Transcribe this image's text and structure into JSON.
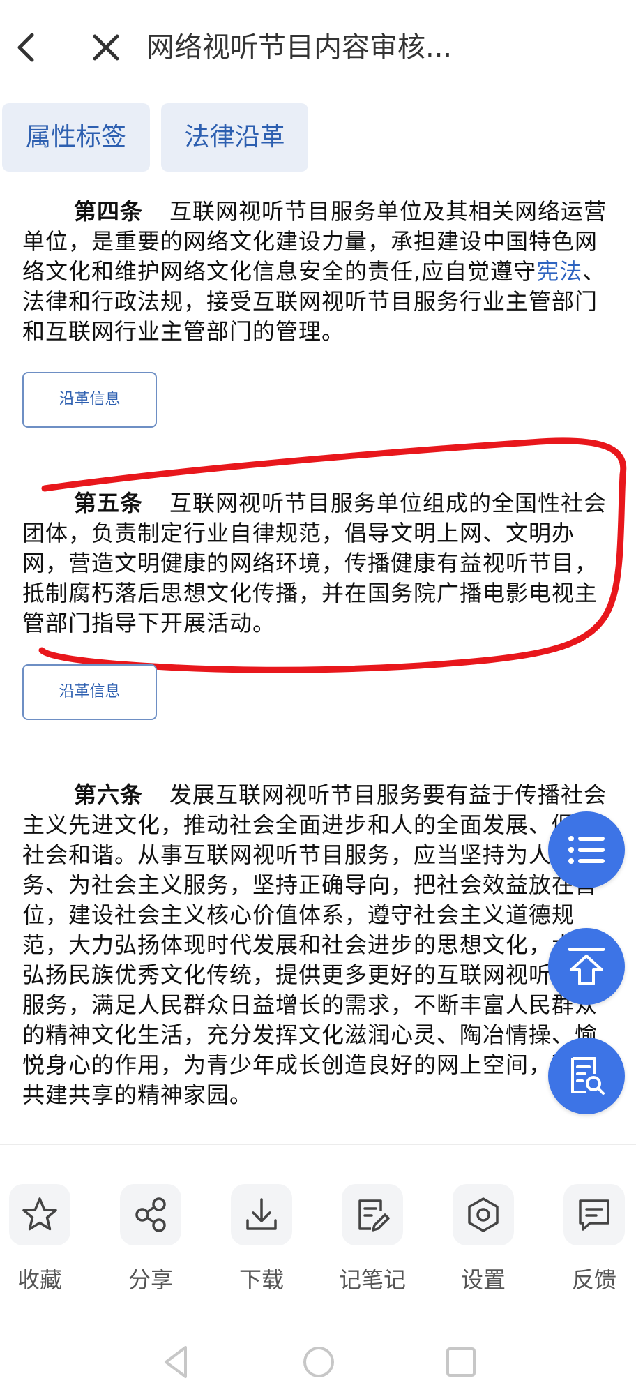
{
  "header": {
    "title": "网络视听节目内容审核..."
  },
  "tabs": [
    {
      "label": "属性标签"
    },
    {
      "label": "法律沿革"
    }
  ],
  "articles": [
    {
      "number": "第四条",
      "text_before_link": "互联网视听节目服务单位及其相关网络运营单位，是重要的网络文化建设力量，承担建设中国特色网络文化和维护网络文化信息安全的责任,应自觉遵守",
      "link": "宪法",
      "text_after_link": "、法律和行政法规，接受互联网视听节目服务行业主管部门和互联网行业主管部门的管理。",
      "history_label": "沿革信息"
    },
    {
      "number": "第五条",
      "text": "互联网视听节目服务单位组成的全国性社会团体，负责制定行业自律规范，倡导文明上网、文明办网，营造文明健康的网络环境，传播健康有益视听节目，抵制腐朽落后思想文化传播，并在国务院广播电影电视主管部门指导下开展活动。",
      "history_label": "沿革信息"
    },
    {
      "number": "第六条",
      "text": "发展互联网视听节目服务要有益于传播社会主义先进文化，推动社会全面进步和人的全面发展、促进社会和谐。从事互联网视听节目服务，应当坚持为人民服务、为社会主义服务，坚持正确导向，把社会效益放在首位，建设社会主义核心价值体系，遵守社会主义道德规范，大力弘扬体现时代发展和社会进步的思想文化，大力弘扬民族优秀文化传统，提供更多更好的互联网视听节目服务，满足人民群众日益增长的需求，不断丰富人民群众的精神文化生活，充分发挥文化滋润心灵、陶冶情操、愉悦身心的作用，为青少年成长创造良好的网上空间，形成共建共享的精神家园。"
    }
  ],
  "fabs": {
    "list_icon": "list-icon",
    "top_icon": "back-to-top-icon",
    "search_icon": "document-search-icon"
  },
  "toolbar": [
    {
      "label": "收藏",
      "icon": "star-icon"
    },
    {
      "label": "分享",
      "icon": "share-icon"
    },
    {
      "label": "下载",
      "icon": "download-icon"
    },
    {
      "label": "记笔记",
      "icon": "note-edit-icon"
    },
    {
      "label": "设置",
      "icon": "settings-icon"
    },
    {
      "label": "反馈",
      "icon": "feedback-icon"
    }
  ],
  "colors": {
    "accent": "#3d74e6",
    "link": "#2f64c0",
    "tab_bg": "#e9eef7",
    "annotation": "#e8171c"
  }
}
